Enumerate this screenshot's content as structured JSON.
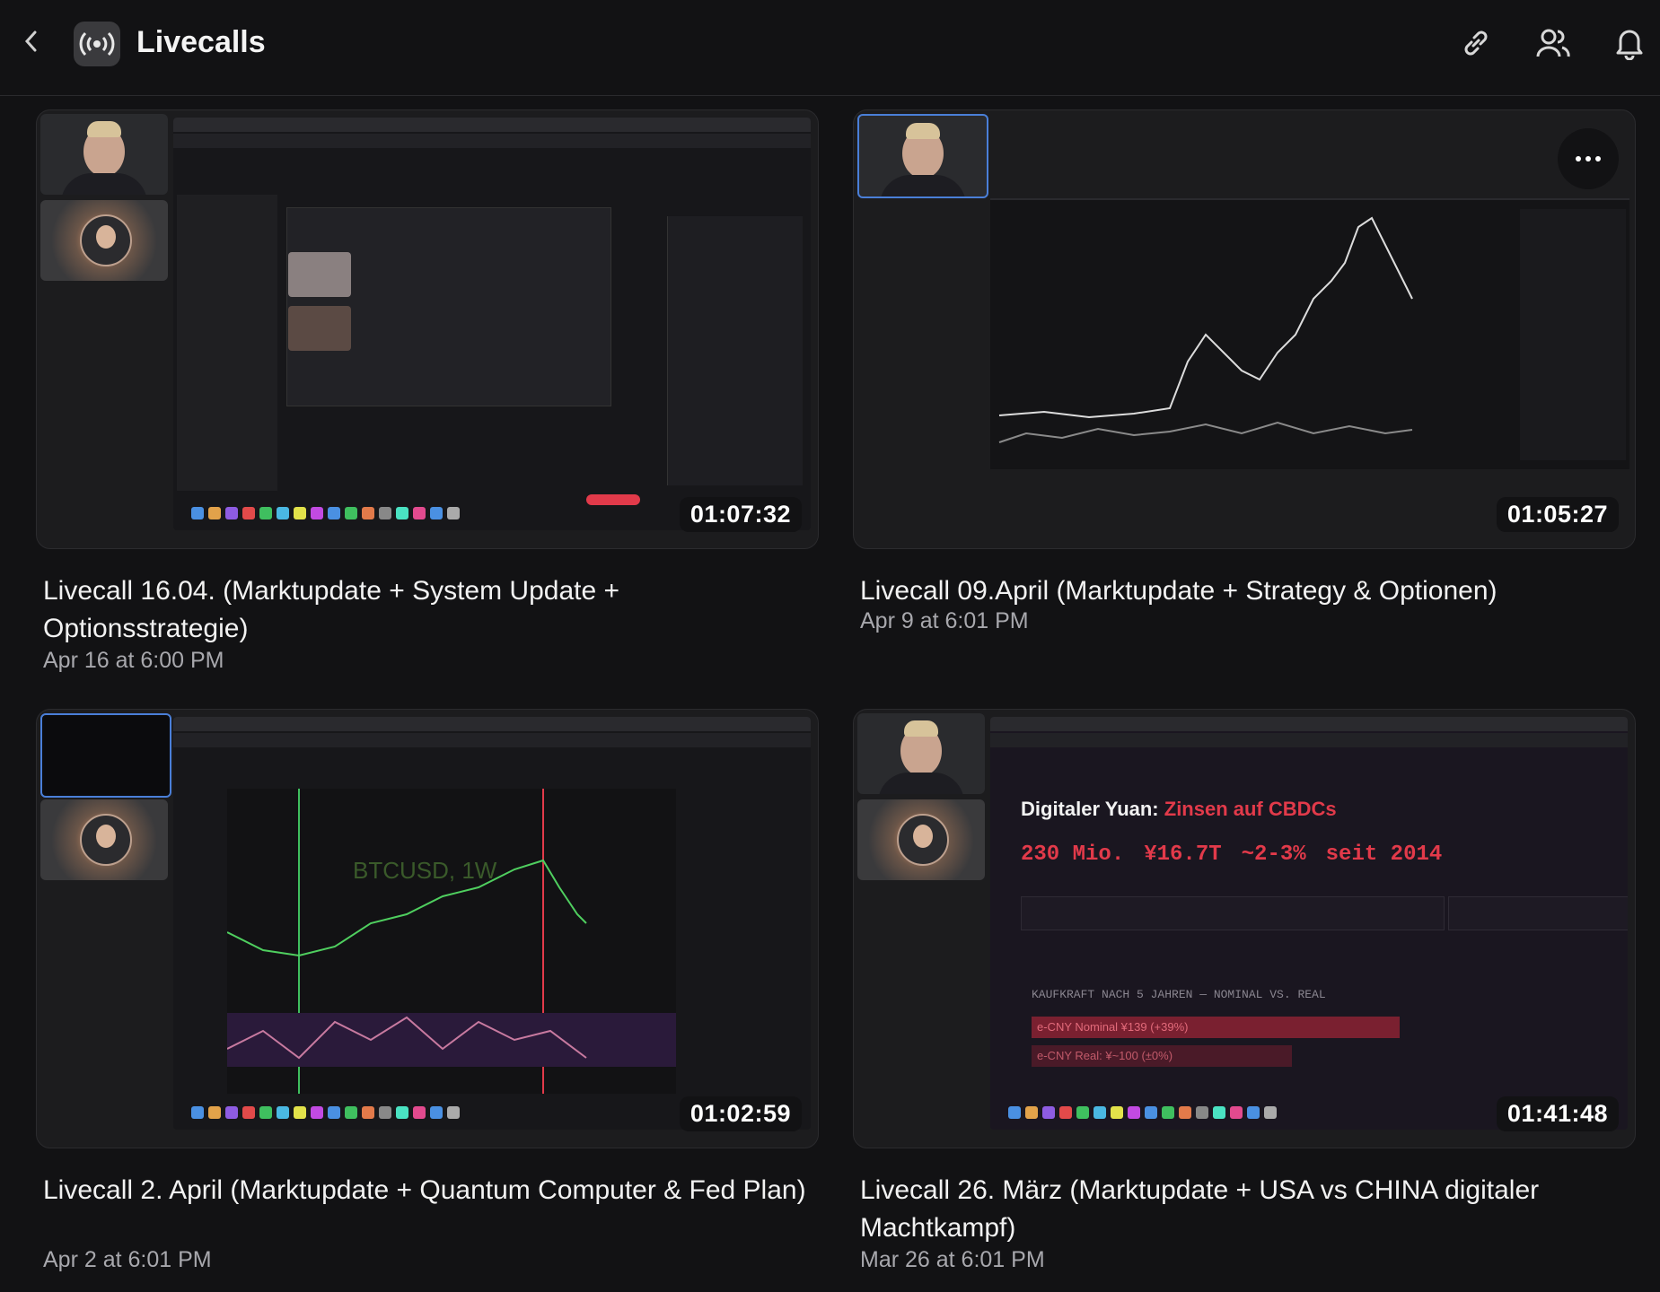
{
  "header": {
    "title": "Livecalls"
  },
  "icons": {
    "back": "chevron-left-icon",
    "app": "broadcast-icon",
    "link": "link-icon",
    "members": "users-icon",
    "notifications": "bell-icon",
    "more": "more-horizontal-icon"
  },
  "cards": [
    {
      "title": "Livecall 16.04. (Marktupdate + System Update + Optionsstrategie)",
      "date": "Apr 16 at 6:00 PM",
      "duration": "01:07:32"
    },
    {
      "title": "Livecall 09.April (Marktupdate + Strategy & Optionen)",
      "date": "Apr 9 at 6:01 PM",
      "duration": "01:05:27"
    },
    {
      "title": "Livecall 2. April (Marktupdate + Quantum Computer & Fed Plan)",
      "date": "Apr 2 at 6:01 PM",
      "duration": "01:02:59"
    },
    {
      "title": "Livecall 26. März (Marktupdate + USA vs CHINA digitaler Machtkampf)",
      "date": "Mar 26 at 6:01 PM",
      "duration": "01:41:48"
    }
  ],
  "slide": {
    "heading": "Digitaler Yuan: ",
    "heading_accent": "Zinsen auf CBDCs",
    "stats": [
      "230 Mio.",
      "¥16.7T",
      "~2-3%",
      "seit 2014"
    ],
    "section": "KAUFKRAFT NACH 5 JAHREN — NOMINAL VS. REAL",
    "bar1": "e-CNY Nominal ¥139 (+39%)",
    "bar2": "e-CNY Real: ¥~100 (±0%)"
  },
  "chart_label": "BTCUSD, 1W",
  "colors": {
    "background": "#121214",
    "accent_red": "#e23a4a",
    "selected_border": "#4a7fd8",
    "muted_text": "#a8a8ad"
  }
}
